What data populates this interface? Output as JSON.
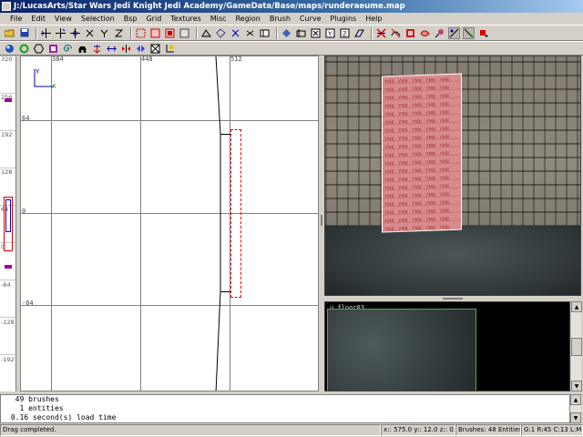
{
  "window": {
    "title": "J:/LucasArts/Star Wars Jedi Knight Jedi Academy/GameData/Base/maps/runderaeume.map"
  },
  "menu": {
    "items": [
      "File",
      "Edit",
      "View",
      "Selection",
      "Bsp",
      "Grid",
      "Textures",
      "Misc",
      "Region",
      "Brush",
      "Curve",
      "Plugins",
      "Help"
    ]
  },
  "toolbar1": {
    "icons": [
      "open-icon",
      "save-icon",
      "flip-x-icon",
      "flip-y-icon",
      "flip-z-icon",
      "rotate-x-icon",
      "rotate-y-icon",
      "rotate-z-icon",
      "select-complete-tall-icon",
      "select-touching-icon",
      "select-partial-tall-icon",
      "select-inside-icon",
      "csg-subtract-icon",
      "csg-merge-icon",
      "hollow-icon",
      "clipper-icon",
      "change-views-icon",
      "texture-view-icon",
      "cubic-clip-icon",
      "camera-movement-icon",
      "x-axis-icon",
      "y-axis-icon",
      "z-axis-icon",
      "entity-list-icon",
      "show-curves-icon",
      "drag-edges-icon",
      "drag-vertices-icon",
      "scale-icon",
      "lock-grid-icon",
      "patch-icon",
      "red-square-icon"
    ]
  },
  "toolbar2": {
    "icons": [
      "blue-sphere-icon",
      "green-cycle-icon",
      "hex-icon",
      "purple-square-icon",
      "spiral-icon",
      "car-icon",
      "arrows-down-icon",
      "arrows-split-icon",
      "red-arrows-icon",
      "blue-diamond-icon",
      "box-x-icon",
      "texture-lock-icon"
    ]
  },
  "zstrip": {
    "labels": [
      "320",
      "256",
      "192",
      "128",
      "64",
      "0",
      "-64",
      "-128",
      "-192"
    ]
  },
  "gridview": {
    "top_ticks": [
      "384",
      "448",
      "512"
    ],
    "left_ticks": [
      "64",
      "0",
      "-64"
    ],
    "axis_y": "Y",
    "axis_x": "X"
  },
  "camera": {
    "panel_text": "YM8 YM8 YM8 YM8 YM8 YM8 YM8 YM8 YM8 YM8 YM8 YM8 YM8 YM8 YM8 YM8 YM8 YM8 YM8 YM8 YM8 YM8 YM8 YM8 YM8 YM8 YM8 YM8 YM8 YM8 YM8 YM8 YM8 YM8 YM8 YM8 YM8 YM8 YM8 YM8 YM8 YM8 YM8 YM8 YM8 YM8 YM8 YM8 YM8 YM8 YM8 YM8 YM8 YM8 YM8 YM8 YM8 YM8 YM8 YM8 YM8 YM8 YM8 YM8 YM8 YM8 YM8 YM8 YM8 YM8 YM8 YM8 YM8 YM8 YM8 YM8 YM8 YM8 YM8 YM8 YM8 YM8 YM8 YM8 YM8 YM8 YM8 YM8 YM8 YM8 YM8 YM8 YM8 YM8 YM8 YM8 YM8 YM8 YM8 YM8"
  },
  "texture_browser": {
    "texture_name": "u_floor03"
  },
  "console": {
    "lines": [
      "  49 brushes",
      "   1 entities",
      " 0.16 second(s) load time"
    ]
  },
  "status": {
    "message": "Drag completed.",
    "coords": "x:: 575.0  y:: 12.0  z:: 0.0",
    "counts": "Brushes: 48 Entities: 1",
    "grid": "G:1 R:45 C:13 L:MR"
  }
}
